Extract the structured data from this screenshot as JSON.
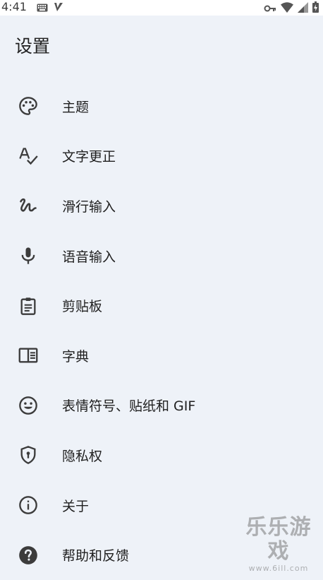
{
  "status_bar": {
    "time": "4:41"
  },
  "page": {
    "title": "设置"
  },
  "menu": {
    "items": [
      {
        "label": "主题",
        "icon": "palette-icon"
      },
      {
        "label": "文字更正",
        "icon": "spellcheck-icon"
      },
      {
        "label": "滑行输入",
        "icon": "gesture-icon"
      },
      {
        "label": "语音输入",
        "icon": "microphone-icon"
      },
      {
        "label": "剪贴板",
        "icon": "clipboard-icon"
      },
      {
        "label": "字典",
        "icon": "dictionary-icon"
      },
      {
        "label": "表情符号、贴纸和 GIF",
        "icon": "emoji-icon"
      },
      {
        "label": "隐私权",
        "icon": "shield-icon"
      },
      {
        "label": "关于",
        "icon": "info-icon"
      },
      {
        "label": "帮助和反馈",
        "icon": "help-icon"
      }
    ]
  },
  "watermark": {
    "title": "乐乐游戏",
    "url": "www.6ill.com"
  },
  "colors": {
    "background": "#eef2f8",
    "icon": "#3c3c3c",
    "text": "#1f1f1f"
  }
}
